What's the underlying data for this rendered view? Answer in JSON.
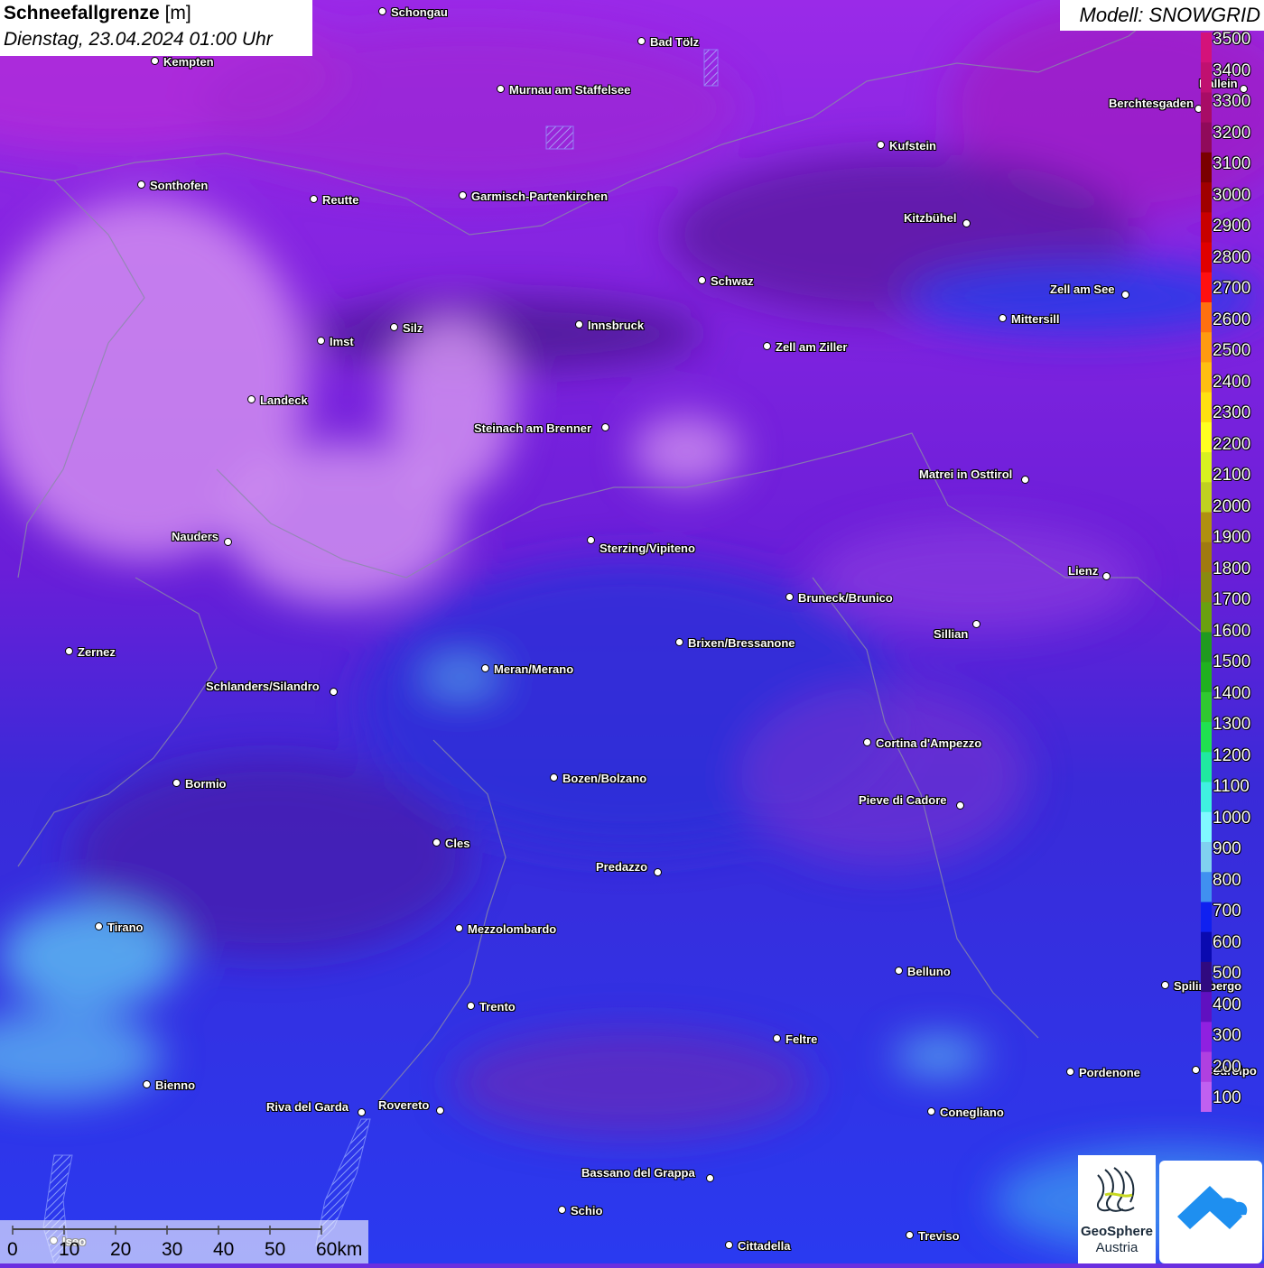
{
  "title": {
    "main": "Schneefallgrenze",
    "unit": "[m]",
    "datetime": "Dienstag, 23.04.2024 01:00 Uhr"
  },
  "model": "Modell: SNOWGRID",
  "legend": {
    "levels": [
      "3500",
      "3400",
      "3300",
      "3200",
      "3100",
      "3000",
      "2900",
      "2800",
      "2700",
      "2600",
      "2500",
      "2400",
      "2300",
      "2200",
      "2100",
      "2000",
      "1900",
      "1800",
      "1700",
      "1600",
      "1500",
      "1400",
      "1300",
      "1200",
      "1100",
      "1000",
      "900",
      "800",
      "700",
      "600",
      "500",
      "400",
      "300",
      "200",
      "100"
    ],
    "colors": [
      "#d4127a",
      "#c01070",
      "#a80c66",
      "#900a5a",
      "#7a0000",
      "#a00000",
      "#c80000",
      "#e00000",
      "#ff1010",
      "#ff7010",
      "#ff9a10",
      "#ffbe10",
      "#ffe010",
      "#ffff20",
      "#d8f020",
      "#c0d020",
      "#b09010",
      "#a07a10",
      "#8a8a10",
      "#6aa010",
      "#209a20",
      "#20b020",
      "#30c830",
      "#20e050",
      "#20e8a0",
      "#40f0e0",
      "#80f8ff",
      "#80d0f0",
      "#4090f0",
      "#1020f0",
      "#0a0ab0",
      "#300a80",
      "#6010c0",
      "#9020e0",
      "#b040e0",
      "#c060f0"
    ]
  },
  "cities": [
    {
      "name": "Schongau"
    },
    {
      "name": "Bad Tölz"
    },
    {
      "name": "Kempten"
    },
    {
      "name": "Murnau am Staffelsee"
    },
    {
      "name": "Kufstein"
    },
    {
      "name": "Berchtesgaden"
    },
    {
      "name": "Hallein"
    },
    {
      "name": "Sonthofen"
    },
    {
      "name": "Reutte"
    },
    {
      "name": "Garmisch-Partenkirchen"
    },
    {
      "name": "Kitzbühel"
    },
    {
      "name": "Schwaz"
    },
    {
      "name": "Zell am See"
    },
    {
      "name": "Mittersill"
    },
    {
      "name": "Innsbruck"
    },
    {
      "name": "Silz"
    },
    {
      "name": "Imst"
    },
    {
      "name": "Zell am Ziller"
    },
    {
      "name": "Landeck"
    },
    {
      "name": "Steinach am Brenner"
    },
    {
      "name": "Matrei in Osttirol"
    },
    {
      "name": "Nauders"
    },
    {
      "name": "Sterzing/Vipiteno"
    },
    {
      "name": "Lienz"
    },
    {
      "name": "Bruneck/Brunico"
    },
    {
      "name": "Sillian"
    },
    {
      "name": "Zernez"
    },
    {
      "name": "Brixen/Bressanone"
    },
    {
      "name": "Meran/Merano"
    },
    {
      "name": "Schlanders/Silandro"
    },
    {
      "name": "Cortina d'Ampezzo"
    },
    {
      "name": "Bozen/Bolzano"
    },
    {
      "name": "Bormio"
    },
    {
      "name": "Pieve di Cadore"
    },
    {
      "name": "Cles"
    },
    {
      "name": "Predazzo"
    },
    {
      "name": "Tirano"
    },
    {
      "name": "Mezzolombardo"
    },
    {
      "name": "Belluno"
    },
    {
      "name": "Spilimbergo"
    },
    {
      "name": "Trento"
    },
    {
      "name": "Feltre"
    },
    {
      "name": "Pordenone"
    },
    {
      "name": "Codroipo"
    },
    {
      "name": "Bienno"
    },
    {
      "name": "Riva del Garda"
    },
    {
      "name": "Rovereto"
    },
    {
      "name": "Conegliano"
    },
    {
      "name": "Bassano del Grappa"
    },
    {
      "name": "Schio"
    },
    {
      "name": "Iseo"
    },
    {
      "name": "Treviso"
    },
    {
      "name": "Cittadella"
    }
  ],
  "scale": {
    "ticks": [
      "0",
      "10",
      "20",
      "30",
      "40",
      "50",
      "60km"
    ]
  },
  "logos": {
    "geosphere_line1": "GeoSphere",
    "geosphere_line2": "Austria"
  }
}
